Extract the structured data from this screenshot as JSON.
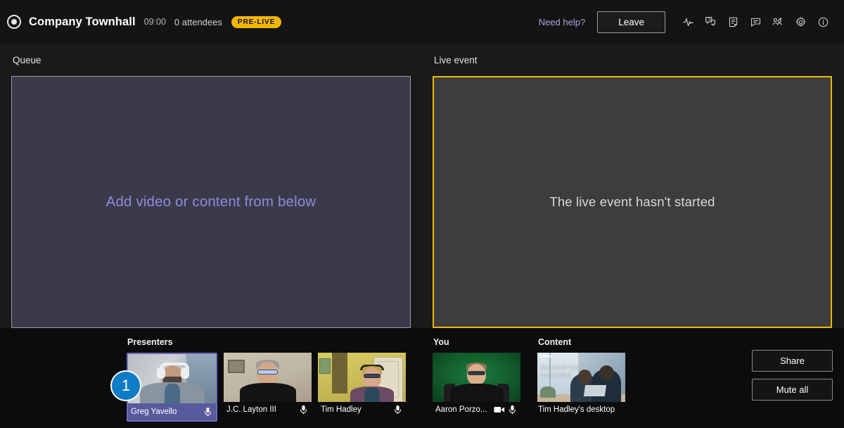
{
  "header": {
    "record_icon": "record-icon",
    "title": "Company Townhall",
    "time": "09:00",
    "attendees": "0 attendees",
    "status_badge": "PRE-LIVE",
    "need_help": "Need help?",
    "leave_label": "Leave",
    "icons": [
      {
        "name": "health-pulse-icon"
      },
      {
        "name": "qna-icon"
      },
      {
        "name": "notes-icon"
      },
      {
        "name": "chat-icon"
      },
      {
        "name": "add-participant-icon"
      },
      {
        "name": "settings-gear-icon"
      },
      {
        "name": "info-icon"
      }
    ],
    "badge_color": "#f2b705"
  },
  "main": {
    "queue": {
      "label": "Queue",
      "placeholder": "Add video or content from below",
      "fill_color": "#3b3a4b",
      "border_color": "#9c9c9c",
      "text_color": "#8f8bdb"
    },
    "live": {
      "label": "Live event",
      "placeholder": "The live event hasn't started",
      "fill_color": "#3d3d3d",
      "border_color": "#ecb800",
      "text_color": "#d8d8d8"
    }
  },
  "bottom": {
    "presenters": {
      "label": "Presenters",
      "tiles": [
        {
          "name": "Greg Yavello",
          "selected": true,
          "badge": "1",
          "mic_icon": "mic-icon",
          "cam": "cam-greg"
        },
        {
          "name": "J.C. Layton III",
          "selected": false,
          "mic_icon": "mic-icon",
          "cam": "cam-jc"
        },
        {
          "name": "Tim Hadley",
          "selected": false,
          "mic_icon": "mic-icon",
          "cam": "cam-tim"
        }
      ]
    },
    "you": {
      "label": "You",
      "tiles": [
        {
          "name": "Aaron Porzo...",
          "camera_icon": "camera-icon",
          "mic_icon": "mic-icon",
          "cam": "cam-aaron"
        }
      ]
    },
    "content": {
      "label": "Content",
      "tiles": [
        {
          "name": "Tim Hadley's desktop",
          "slide_title": "Microsoft Teams Immersion"
        }
      ]
    },
    "actions": {
      "share_label": "Share",
      "mute_all_label": "Mute all"
    },
    "selected_border_color": "#6b6cc0",
    "badge_color": "#0f7cc6"
  }
}
